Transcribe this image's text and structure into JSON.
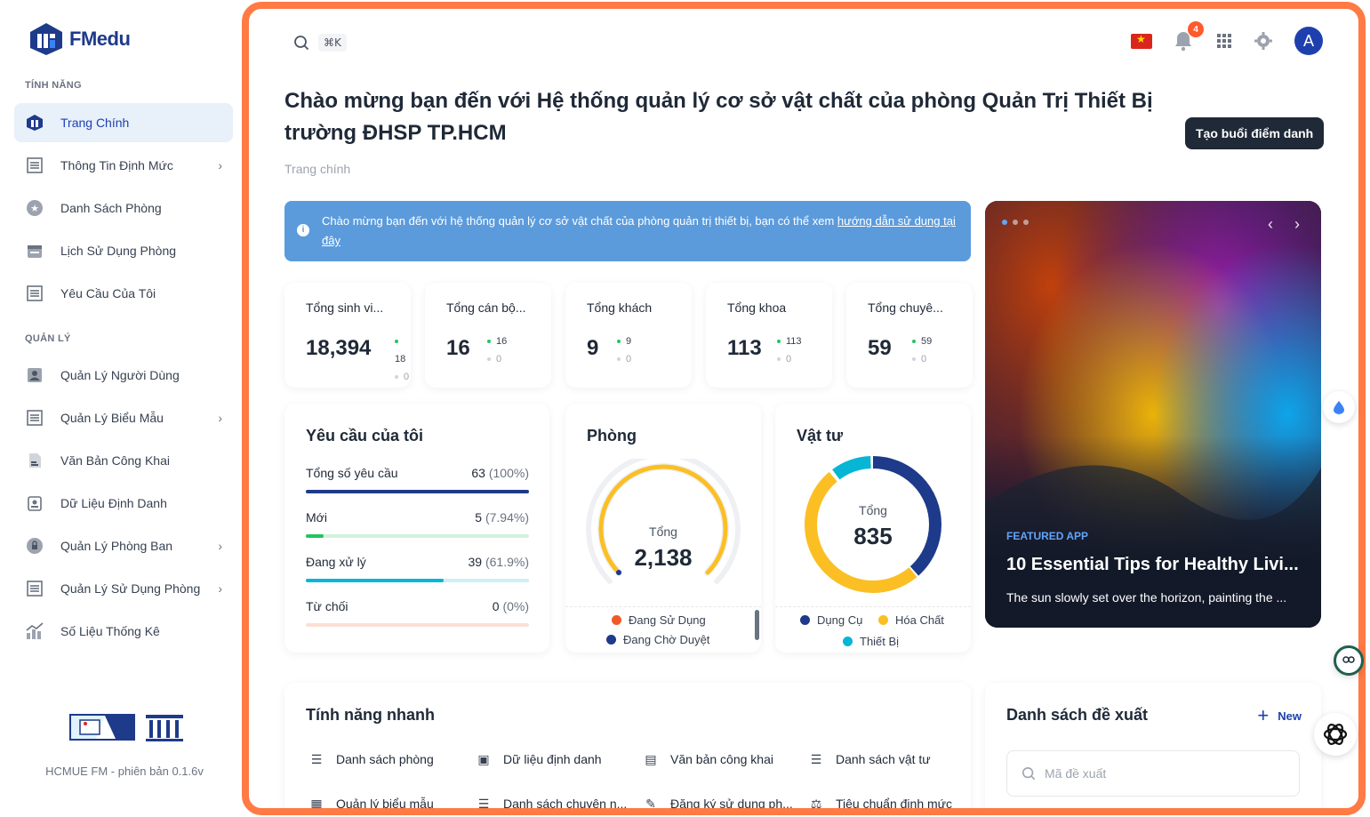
{
  "app": {
    "logo_text": "FMedu",
    "version": "HCMUE FM - phiên bản 0.1.6v"
  },
  "sidebar": {
    "section_features": "TÍNH NĂNG",
    "section_manage": "QUẢN LÝ",
    "items": [
      {
        "label": "Trang Chính",
        "icon": "home-icon",
        "active": true
      },
      {
        "label": "Thông Tin Định Mức",
        "icon": "list-icon",
        "chevron": true
      },
      {
        "label": "Danh Sách Phòng",
        "icon": "star-icon"
      },
      {
        "label": "Lịch Sử Dụng Phòng",
        "icon": "calendar-icon"
      },
      {
        "label": "Yêu Cầu Của Tôi",
        "icon": "list-icon"
      }
    ],
    "manage_items": [
      {
        "label": "Quản Lý Người Dùng",
        "icon": "user-icon"
      },
      {
        "label": "Quản Lý Biểu Mẫu",
        "icon": "list-icon",
        "chevron": true
      },
      {
        "label": "Văn Bản Công Khai",
        "icon": "document-icon"
      },
      {
        "label": "Dữ Liệu Định Danh",
        "icon": "id-card-icon"
      },
      {
        "label": "Quản Lý Phòng Ban",
        "icon": "lock-icon",
        "chevron": true
      },
      {
        "label": "Quản Lý Sử Dụng Phòng",
        "icon": "list-icon",
        "chevron": true
      },
      {
        "label": "Số Liệu Thống Kê",
        "icon": "chart-icon"
      }
    ]
  },
  "topbar": {
    "shortcut": "⌘K",
    "notification_count": "4",
    "avatar_letter": "A"
  },
  "header": {
    "title": "Chào mừng bạn đến với Hệ thống quản lý cơ sở vật chất của phòng Quản Trị Thiết Bị trường ĐHSP TP.HCM",
    "breadcrumb": "Trang chính",
    "action_button": "Tạo buổi điểm danh"
  },
  "banner": {
    "text": "Chào mừng bạn đến với hệ thống quản lý cơ sở vật chất của phòng quản trị thiết bị, bạn có thể xem ",
    "link": "hướng dẫn sử dụng tại đây"
  },
  "stats": [
    {
      "label": "Tổng sinh vi...",
      "value": "18,394",
      "up": "18",
      "down": "0"
    },
    {
      "label": "Tổng cán bộ...",
      "value": "16",
      "up": "16",
      "down": "0"
    },
    {
      "label": "Tổng khách",
      "value": "9",
      "up": "9",
      "down": "0"
    },
    {
      "label": "Tổng khoa",
      "value": "113",
      "up": "113",
      "down": "0"
    },
    {
      "label": "Tổng chuyê...",
      "value": "59",
      "up": "59",
      "down": "0"
    }
  ],
  "requests": {
    "title": "Yêu cầu của tôi",
    "rows": [
      {
        "name": "Tổng số yêu cầu",
        "count": "63",
        "pct": "(100%)",
        "fraction": 1.0,
        "color": "#1e3a8a",
        "track": "#dbe3f0"
      },
      {
        "name": "Mới",
        "count": "5",
        "pct": "(7.94%)",
        "fraction": 0.0794,
        "color": "#22c55e",
        "track": "#d1f2dc"
      },
      {
        "name": "Đang xử lý",
        "count": "39",
        "pct": "(61.9%)",
        "fraction": 0.619,
        "color": "#06b6d4",
        "track": "#cdeff5"
      },
      {
        "name": "Từ chối",
        "count": "0",
        "pct": "(0%)",
        "fraction": 0.0,
        "color": "#f87171",
        "track": "#fbe0d6"
      }
    ]
  },
  "rooms": {
    "title": "Phòng",
    "total_label": "Tổng",
    "total": "2,138",
    "legend": [
      {
        "label": "Đang Sử Dụng",
        "color": "#f05a28"
      },
      {
        "label": "Đang Chờ Duyệt",
        "color": "#1e3a8a"
      }
    ]
  },
  "supplies": {
    "title": "Vật tư",
    "total_label": "Tổng",
    "total": "835",
    "legend": [
      {
        "label": "Dụng Cụ",
        "color": "#1e3a8a"
      },
      {
        "label": "Hóa Chất",
        "color": "#fbbf24"
      },
      {
        "label": "Thiết Bị",
        "color": "#06b6d4"
      }
    ]
  },
  "promo": {
    "tag": "FEATURED APP",
    "title": "10 Essential Tips for Healthy Livi...",
    "description": "The sun slowly set over the horizon, painting the ..."
  },
  "quick": {
    "title": "Tính năng nhanh",
    "items": [
      {
        "label": "Danh sách phòng",
        "icon": "list-icon"
      },
      {
        "label": "Dữ liệu định danh",
        "icon": "id-card-icon"
      },
      {
        "label": "Văn bản công khai",
        "icon": "document-icon"
      },
      {
        "label": "Danh sách vật tư",
        "icon": "list-icon"
      },
      {
        "label": "Quản lý biểu mẫu",
        "icon": "form-icon"
      },
      {
        "label": "Danh sách chuyên n...",
        "icon": "list-icon"
      },
      {
        "label": "Đăng ký sử dụng ph...",
        "icon": "pen-icon"
      },
      {
        "label": "Tiêu chuẩn định mức",
        "icon": "scale-icon"
      }
    ]
  },
  "proposals": {
    "title": "Danh sách đề xuất",
    "new_label": "New",
    "search_placeholder": "Mã đề xuất"
  }
}
